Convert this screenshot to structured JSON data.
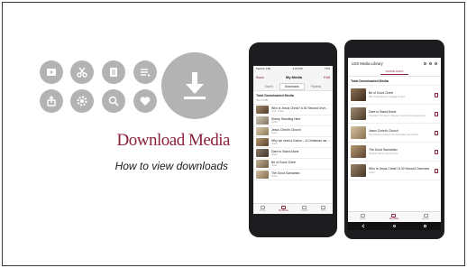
{
  "slide": {
    "title": "Download Media",
    "subtitle": "How to view downloads"
  },
  "icons": [
    {
      "name": "video-icon"
    },
    {
      "name": "scissors-icon"
    },
    {
      "name": "book-icon"
    },
    {
      "name": "playlist-icon"
    },
    {
      "name": "share-icon"
    },
    {
      "name": "gear-icon"
    },
    {
      "name": "search-icon"
    },
    {
      "name": "heart-icon"
    },
    {
      "name": "download-icon"
    }
  ],
  "iphone": {
    "status_left": "Verizon LTE",
    "status_time": "4:21 PM",
    "status_right": "77%",
    "nav_left": "Back",
    "nav_title": "My Media",
    "nav_right": "Edit",
    "segments": [
      "Saved",
      "Downloads",
      "Playlists"
    ],
    "summary_label": "Total Downloaded Media",
    "summary_size": "312.3 MB",
    "items": [
      {
        "title": "Who is Jesus Christ? A 30 Second Overview",
        "sub": "4:43 · Video"
      },
      {
        "title": "Sheep Standing Here",
        "sub": "Audio"
      },
      {
        "title": "Jesus Christ's Church",
        "sub": "Video"
      },
      {
        "title": "Why we need a Savior – A Christmas message from",
        "sub": "Video"
      },
      {
        "title": "Dare to Stand Alone",
        "sub": "Video"
      },
      {
        "title": "Be of Good Cheer",
        "sub": "Video"
      },
      {
        "title": "The Good Samaritan",
        "sub": "Video"
      }
    ],
    "tabs": [
      "Home",
      "My Media",
      "Search",
      "More"
    ],
    "colors": {
      "accent": "#8a2339"
    }
  },
  "android": {
    "title": "LDS Media Library",
    "tab": "DOWNLOADS",
    "summary_label": "Total Downloaded Media",
    "summary_size": "",
    "items": [
      {
        "title": "Be of Good Cheer",
        "sub": "Brief inspirational message of hope"
      },
      {
        "title": "Dare to Stand Alone",
        "sub": "President Thomas S. Monson recounts the experience"
      },
      {
        "title": "Jesus Christ's Church",
        "sub": "The Church of Jesus Christ of Latter-day Saints"
      },
      {
        "title": "The Good Samaritan",
        "sub": "Parable told by Jesus Christ"
      },
      {
        "title": "Who Is Jesus Christ? A 30 Second Overview",
        "sub": "Video"
      }
    ],
    "tabs": [
      "Home",
      "My Media",
      "Search"
    ]
  }
}
